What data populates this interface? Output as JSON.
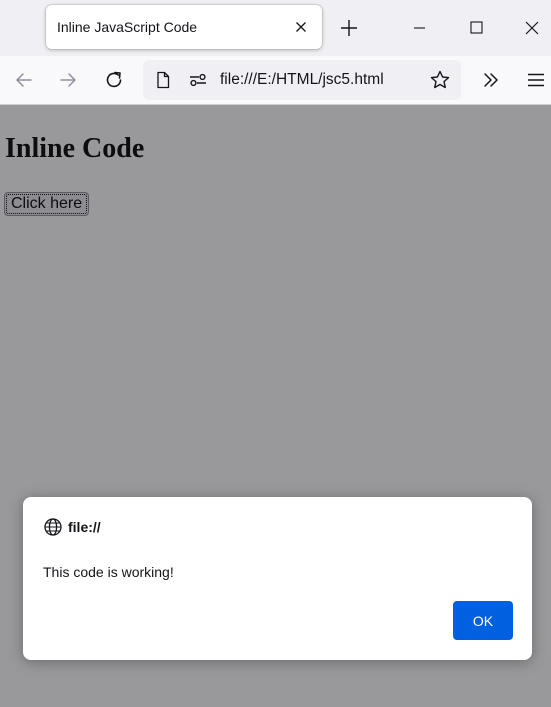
{
  "browser": {
    "tab": {
      "title": "Inline JavaScript Code"
    },
    "address_bar": {
      "url": "file:///E:/HTML/jsc5.html"
    }
  },
  "page": {
    "heading": "Inline Code",
    "button_label": "Click here"
  },
  "alert": {
    "origin": "file://",
    "message": "This code is working!",
    "ok_label": "OK"
  },
  "colors": {
    "accent": "#0061e0",
    "overlay": "#1c1b22"
  }
}
